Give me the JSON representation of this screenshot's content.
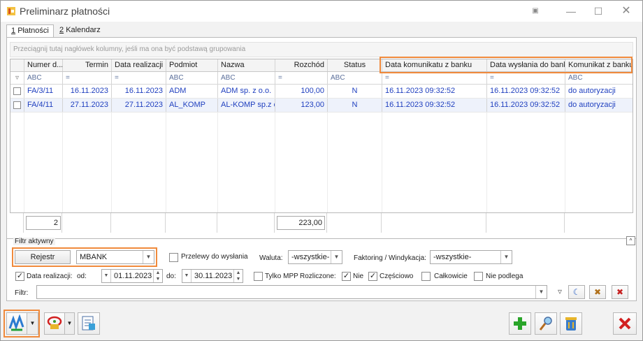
{
  "window": {
    "title": "Preliminarz płatności"
  },
  "tabs": [
    {
      "key": "1",
      "label": "Płatności"
    },
    {
      "key": "2",
      "label": "Kalendarz"
    }
  ],
  "grid": {
    "group_hint": "Przeciągnij tutaj nagłówek kolumny, jeśli ma ona być podstawą grupowania",
    "columns": [
      "Numer d...",
      "Termin",
      "Data realizacji",
      "Podmiot",
      "Nazwa",
      "Rozchód",
      "Status",
      "Data komunikatu z banku",
      "Data wysłania do banku",
      "Komunikat z banku"
    ],
    "filter_row": [
      "ABC",
      "=",
      "=",
      "ABC",
      "ABC",
      "=",
      "ABC",
      "=",
      "=",
      "ABC"
    ],
    "rows": [
      {
        "numer": "FA/3/11",
        "termin": "16.11.2023",
        "data_realizacji": "16.11.2023",
        "podmiot": "ADM",
        "nazwa": "ADM sp. z o.o.",
        "rozchod": "100,00",
        "status": "N",
        "data_komunikatu": "16.11.2023 09:32:52",
        "data_wyslania": "16.11.2023 09:32:52",
        "komunikat": "do autoryzacji"
      },
      {
        "numer": "FA/4/11",
        "termin": "27.11.2023",
        "data_realizacji": "27.11.2023",
        "podmiot": "AL_KOMP",
        "nazwa": "AL-KOMP sp.z o...",
        "rozchod": "123,00",
        "status": "N",
        "data_komunikatu": "16.11.2023 09:32:52",
        "data_wyslania": "16.11.2023 09:32:52",
        "komunikat": "do autoryzacji"
      }
    ],
    "footer": {
      "count": "2",
      "sum": "223,00"
    }
  },
  "filters": {
    "section_title": "Filtr aktywny",
    "rejestr_button": "Rejestr",
    "rejestr_value": "MBANK",
    "przelewy_label": "Przelewy do wysłania",
    "waluta_label": "Waluta:",
    "waluta_value": "-wszystkie-",
    "faktoring_label": "Faktoring / Windykacja:",
    "faktoring_value": "-wszystkie-",
    "data_realizacji_label": "Data realizacji:",
    "od_label": "od:",
    "od_value": "01.11.2023",
    "do_label": "do:",
    "do_value": "30.11.2023",
    "tylko_mpp_label": "Tylko MPP",
    "rozliczone_label": "Rozliczone:",
    "nie_label": "Nie",
    "czesciowo_label": "Częściowo",
    "calkowicie_label": "Całkowicie",
    "nie_podlega_label": "Nie podlega",
    "filtr_label": "Filtr:"
  },
  "colors": {
    "highlight": "#f08a3c",
    "link_text": "#1f3fbf",
    "add": "#2aa52a",
    "close": "#d22020"
  }
}
